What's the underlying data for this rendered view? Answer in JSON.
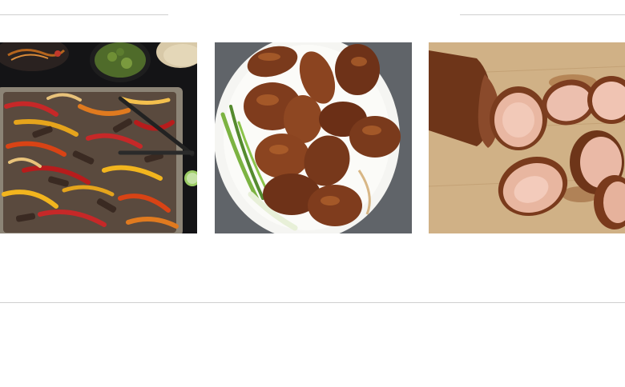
{
  "recipes": [
    {
      "image": "steak-fajitas-sheet-pan-photo",
      "alt": ""
    },
    {
      "image": "roast-glazed-chicken-platter-photo",
      "alt": ""
    },
    {
      "image": "sliced-pork-tenderloin-photo",
      "alt": ""
    }
  ],
  "colors": {
    "rule": "#cfcfcf",
    "background": "#ffffff"
  }
}
